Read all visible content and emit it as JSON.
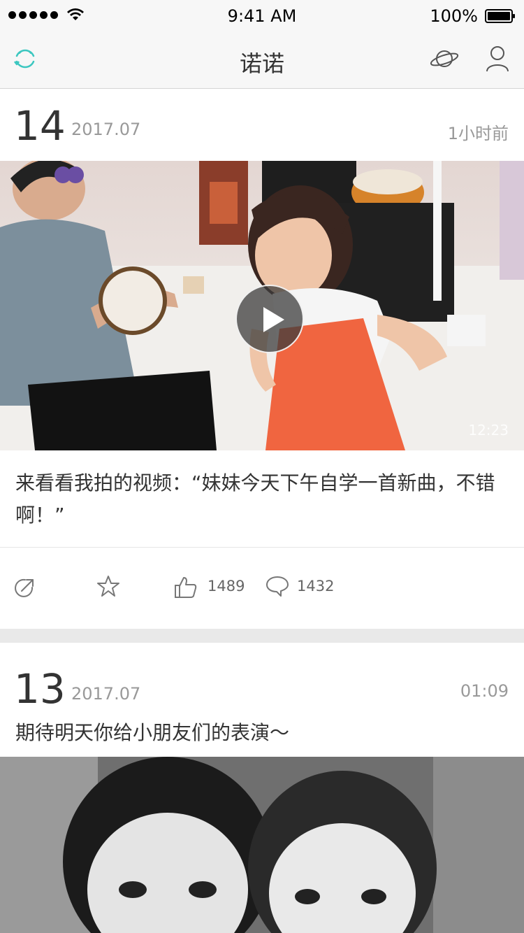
{
  "status_bar": {
    "time": "9:41 AM",
    "battery": "100%"
  },
  "nav": {
    "title": "诺诺"
  },
  "posts": [
    {
      "day": "14",
      "month": "2017.07",
      "time_ago": "1小时前",
      "media_type": "video",
      "duration": "12:23",
      "text": "来看看我拍的视频：“妹妹今天下午自学一首新曲，不错啊！”",
      "likes": "1489",
      "comments": "1432"
    },
    {
      "day": "13",
      "month": "2017.07",
      "time_ago": "01:09",
      "media_type": "photo",
      "text": "期待明天你给小朋友们的表演～"
    }
  ],
  "colors": {
    "accent": "#3cc7c0",
    "text": "#333333",
    "muted": "#999999",
    "nav_bg": "#f7f7f7"
  }
}
